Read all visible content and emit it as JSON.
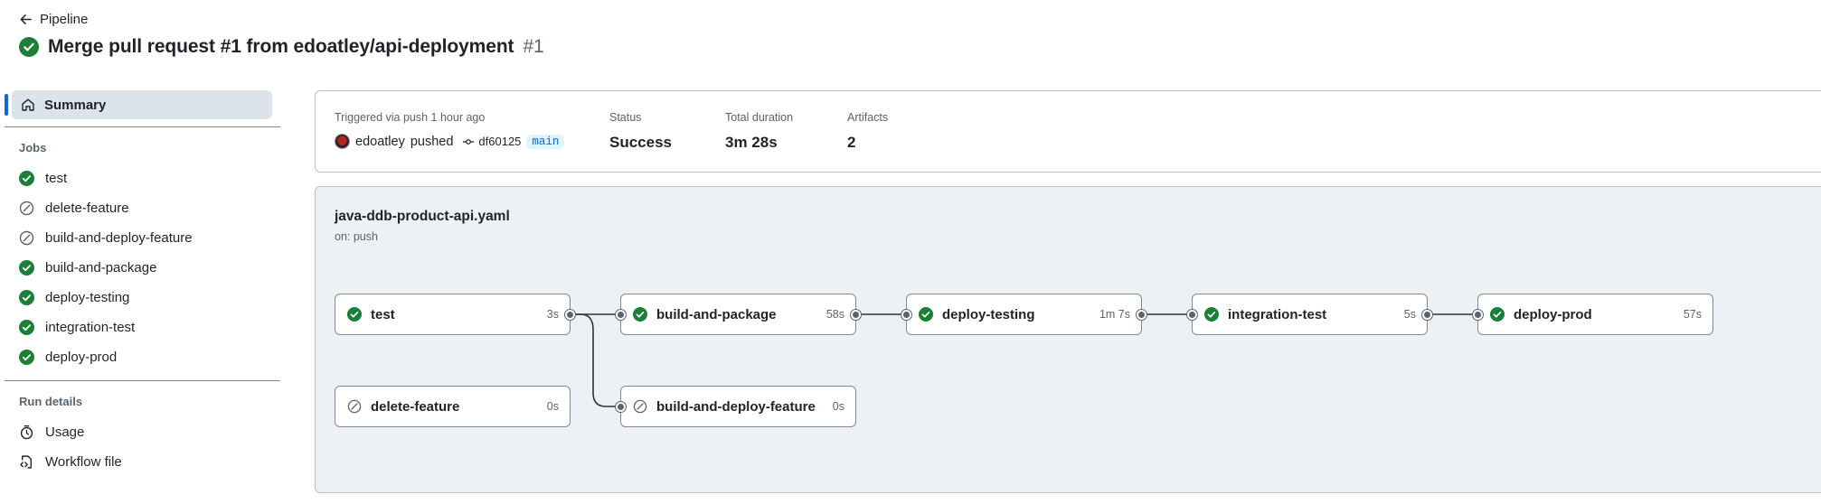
{
  "header": {
    "back_label": "Pipeline",
    "title": "Merge pull request #1 from edoatley/api-deployment",
    "run_number": "#1",
    "status_icon": "check-circle-fill-icon"
  },
  "sidebar": {
    "summary_label": "Summary",
    "jobs_heading": "Jobs",
    "jobs": [
      {
        "name": "test",
        "status": "success"
      },
      {
        "name": "delete-feature",
        "status": "skipped"
      },
      {
        "name": "build-and-deploy-feature",
        "status": "skipped"
      },
      {
        "name": "build-and-package",
        "status": "success"
      },
      {
        "name": "deploy-testing",
        "status": "success"
      },
      {
        "name": "integration-test",
        "status": "success"
      },
      {
        "name": "deploy-prod",
        "status": "success"
      }
    ],
    "run_details_heading": "Run details",
    "run_details": [
      {
        "label": "Usage",
        "icon": "stopwatch-icon"
      },
      {
        "label": "Workflow file",
        "icon": "file-code-icon"
      }
    ]
  },
  "summary": {
    "trigger_label": "Triggered via push 1 hour ago",
    "actor": "edoatley",
    "actor_action": "pushed",
    "commit": "df60125",
    "branch": "main",
    "status_label": "Status",
    "status_value": "Success",
    "duration_label": "Total duration",
    "duration_value": "3m 28s",
    "artifacts_label": "Artifacts",
    "artifacts_value": "2"
  },
  "workflow": {
    "file": "java-ddb-product-api.yaml",
    "trigger": "on: push",
    "jobs": [
      {
        "name": "test",
        "duration": "3s",
        "status": "success"
      },
      {
        "name": "build-and-package",
        "duration": "58s",
        "status": "success"
      },
      {
        "name": "deploy-testing",
        "duration": "1m 7s",
        "status": "success"
      },
      {
        "name": "integration-test",
        "duration": "5s",
        "status": "success"
      },
      {
        "name": "deploy-prod",
        "duration": "57s",
        "status": "success"
      },
      {
        "name": "delete-feature",
        "duration": "0s",
        "status": "skipped"
      },
      {
        "name": "build-and-deploy-feature",
        "duration": "0s",
        "status": "skipped"
      }
    ]
  },
  "colors": {
    "success": "#1a7f37",
    "accent": "#0969da",
    "graph_background": "#eef1f4"
  }
}
